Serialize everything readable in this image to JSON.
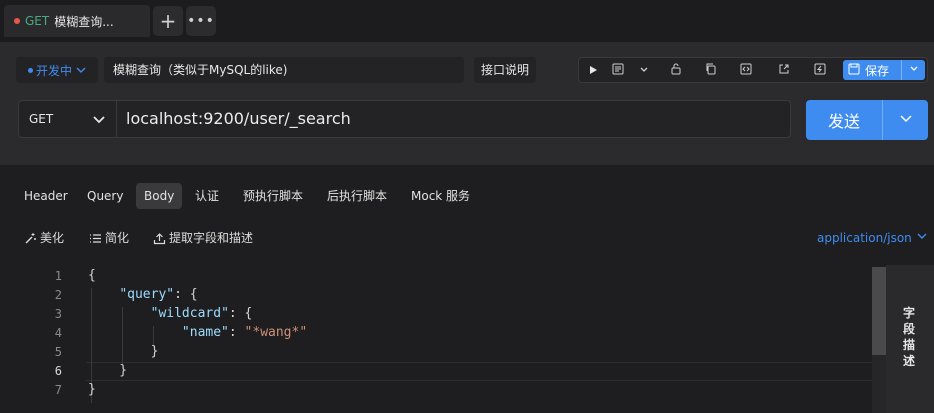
{
  "tab": {
    "method": "GET",
    "name": "模糊查询...",
    "add": "+",
    "more": "•••"
  },
  "request": {
    "status": "开发中",
    "name": "模糊查询（类似于MySQL的like)",
    "doc_label": "接口说明",
    "save_label": "保存",
    "method": "GET",
    "url": "localhost:9200/user/_search",
    "send_label": "发送"
  },
  "subtabs": [
    "Header",
    "Query",
    "Body",
    "认证",
    "预执行脚本",
    "后执行脚本",
    "Mock 服务"
  ],
  "body_tools": {
    "beautify": "美化",
    "simplify": "简化",
    "extract": "提取字段和描述",
    "content_type": "application/json"
  },
  "editor": {
    "line_numbers": [
      "1",
      "2",
      "3",
      "4",
      "5",
      "6",
      "7"
    ],
    "current_line": "6"
  },
  "side_label": "字段描述",
  "colors": {
    "accent": "#3f8cf0",
    "tab_dot": "#e8584a",
    "method_get": "#4aa883"
  }
}
